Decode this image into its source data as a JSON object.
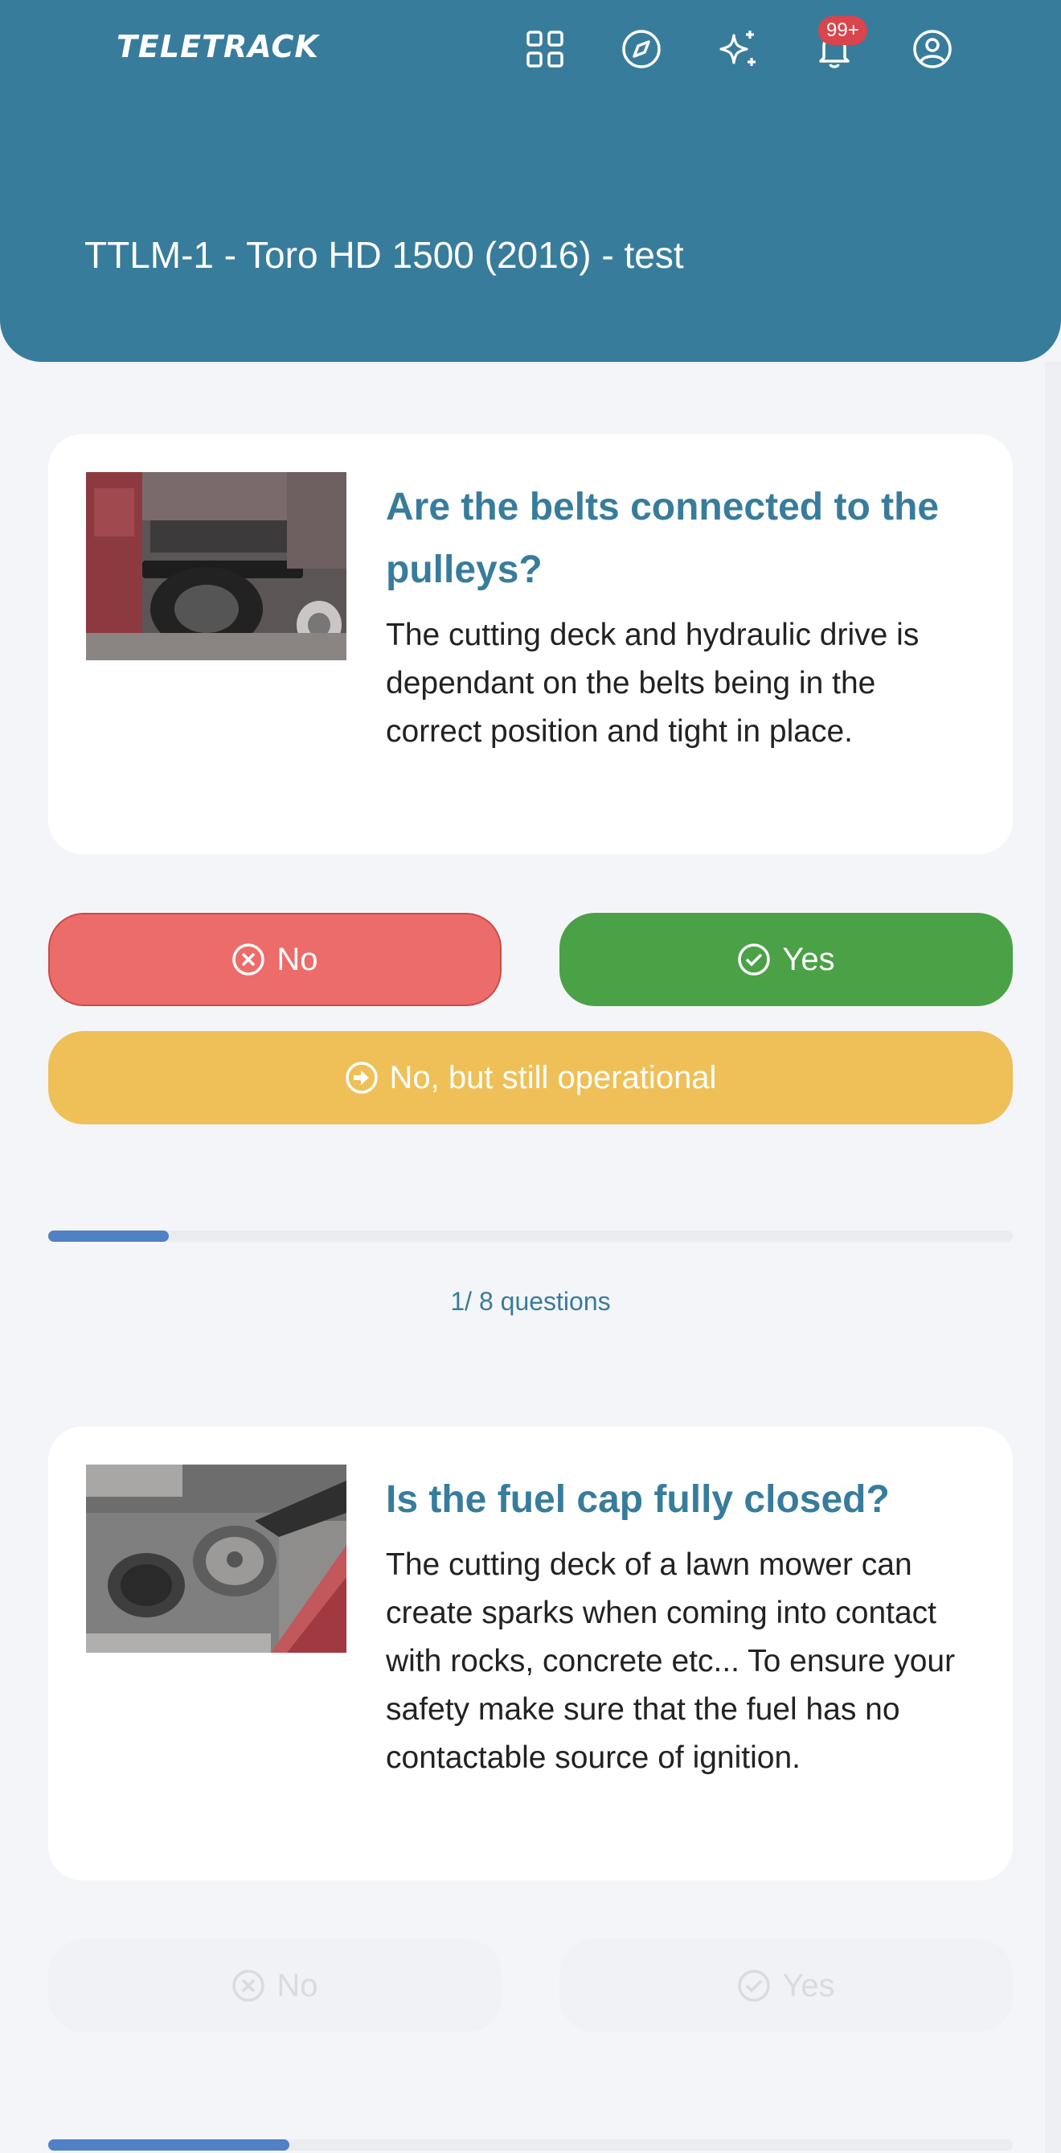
{
  "header": {
    "logo_text": "TELETRACK",
    "notification_count": "99+",
    "page_title": "TTLM-1 - Toro HD 1500 (2016) - test",
    "background_color": "#387c9c",
    "icons": [
      "apps-grid-icon",
      "compass-icon",
      "sparkles-icon",
      "bell-icon",
      "user-circle-icon"
    ]
  },
  "questions": [
    {
      "title": "Are the belts connected to the pulleys?",
      "description": "The cutting deck and hydraulic drive is dependant on the belts being in the correct position and tight in place.",
      "image": "mower-belt-photo",
      "buttons": {
        "no": "No",
        "yes": "Yes",
        "partial": "No, but still operational"
      },
      "progress": {
        "label": "1/ 8 questions",
        "fraction": 0.125
      }
    },
    {
      "title": "Is the fuel cap fully closed?",
      "description": "The cutting deck of a lawn mower can create sparks when coming into contact with rocks, concrete etc... To ensure your safety make sure that the fuel has no contactable source of ignition.",
      "image": "fuel-cap-photo",
      "buttons": {
        "no": "No",
        "yes": "Yes"
      },
      "progress": {
        "fraction": 0.25
      }
    }
  ],
  "colors": {
    "no": "#ec6c69",
    "yes": "#4aa146",
    "partial": "#eec057",
    "progress": "#5080c5",
    "accent": "#387c9c"
  }
}
